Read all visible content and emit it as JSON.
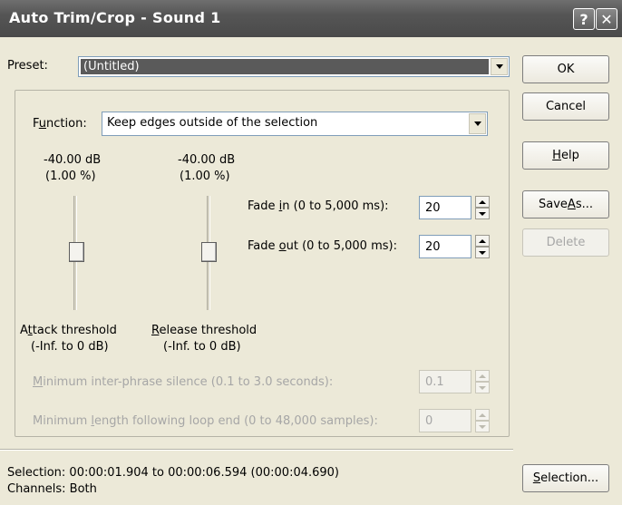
{
  "window": {
    "title": "Auto Trim/Crop - Sound 1",
    "help_glyph": "?",
    "close_glyph": "✕"
  },
  "preset": {
    "label": "Preset:",
    "value": "(Untitled)"
  },
  "function": {
    "label_pre": "F",
    "label_u": "u",
    "label_post": "nction:",
    "value": "Keep edges outside of the selection"
  },
  "attack": {
    "db": "-40.00 dB",
    "pct": "(1.00 %)",
    "label_pre": "A",
    "label_u": "t",
    "label_post": "tack threshold",
    "range": "(-Inf. to 0 dB)"
  },
  "release": {
    "db": "-40.00 dB",
    "pct": "(1.00 %)",
    "label_u": "R",
    "label_post": "elease threshold",
    "range": "(-Inf. to 0 dB)"
  },
  "fade_in": {
    "label_pre": "Fade ",
    "label_u": "i",
    "label_post": "n (0 to 5,000 ms):",
    "value": "20"
  },
  "fade_out": {
    "label_pre": "Fade ",
    "label_u": "o",
    "label_post": "ut (0 to 5,000 ms):",
    "value": "20"
  },
  "min_silence": {
    "label_u": "M",
    "label_post": "inimum inter-phrase silence (0.1 to 3.0 seconds):",
    "value": "0.1"
  },
  "min_length": {
    "label_pre": "Minimum ",
    "label_u": "l",
    "label_post": "ength following loop end (0 to 48,000 samples):",
    "value": "0"
  },
  "buttons": {
    "ok": "OK",
    "cancel": "Cancel",
    "help_u": "H",
    "help_post": "elp",
    "save_pre": "Save ",
    "save_u": "A",
    "save_post": "s...",
    "delete": "Delete",
    "selection_u": "S",
    "selection_post": "election..."
  },
  "status": {
    "selection": "Selection:  00:00:01.904 to 00:00:06.594 (00:00:04.690)",
    "channels": "Channels:  Both"
  }
}
